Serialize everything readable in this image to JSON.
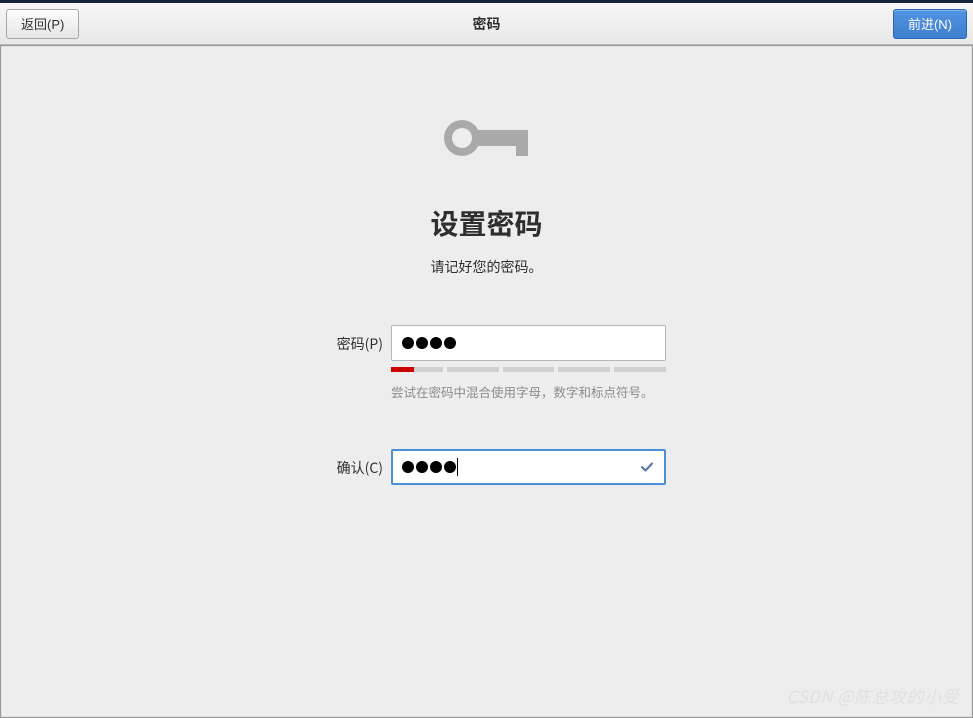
{
  "header": {
    "title": "密码",
    "back_label": "返回(P)",
    "next_label": "前进(N)"
  },
  "main": {
    "heading": "设置密码",
    "subheading": "请记好您的密码。"
  },
  "form": {
    "password_label": "密码(P)",
    "confirm_label": "确认(C)",
    "password_dots": 4,
    "confirm_dots": 4,
    "strength_hint": "尝试在密码中混合使用字母，数字和标点符号。",
    "strength_segments": 5,
    "strength_fill_percent": 45,
    "confirm_matches": true
  },
  "watermark": "CSDN @陈总攻的小受"
}
